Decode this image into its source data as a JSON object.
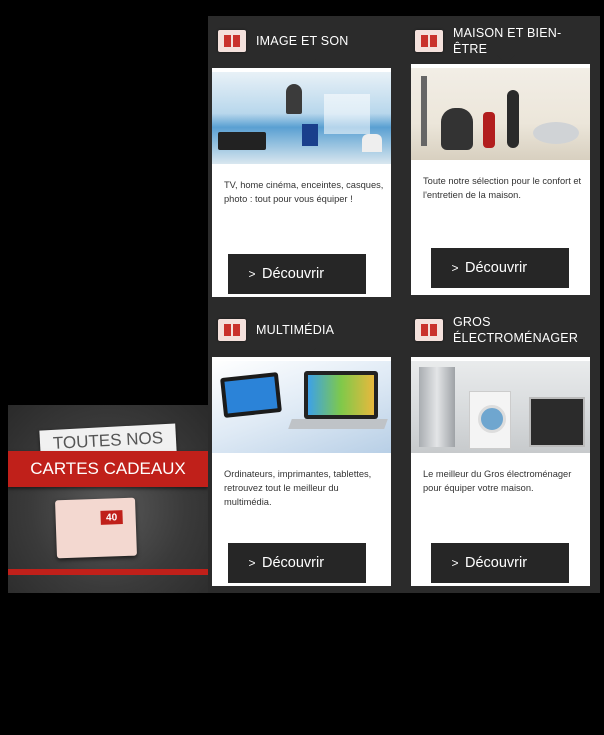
{
  "promo": {
    "line1": "TOUTES NOS",
    "line2": "CARTES CADEAUX",
    "card_value": "40"
  },
  "cards": [
    {
      "title": "IMAGE ET SON",
      "description": "TV, home cinéma, enceintes, casques, photo : tout pour vous équiper !",
      "button": "Découvrir"
    },
    {
      "title": "MAISON ET BIEN-ÊTRE",
      "description": "Toute notre sélection pour le confort et l'entretien de la maison.",
      "button": "Découvrir"
    },
    {
      "title": "MULTIMÉDIA",
      "description": "Ordinateurs, imprimantes, tablettes, retrouvez tout le meilleur du multimédia.",
      "button": "Découvrir"
    },
    {
      "title": "GROS ÉLECTROMÉNAGER",
      "description": "Le meilleur du Gros électroménager pour équiper votre maison.",
      "button": "Découvrir"
    }
  ],
  "colors": {
    "panel": "#2b2b2b",
    "button": "#262626",
    "accent_red": "#c0201a"
  }
}
